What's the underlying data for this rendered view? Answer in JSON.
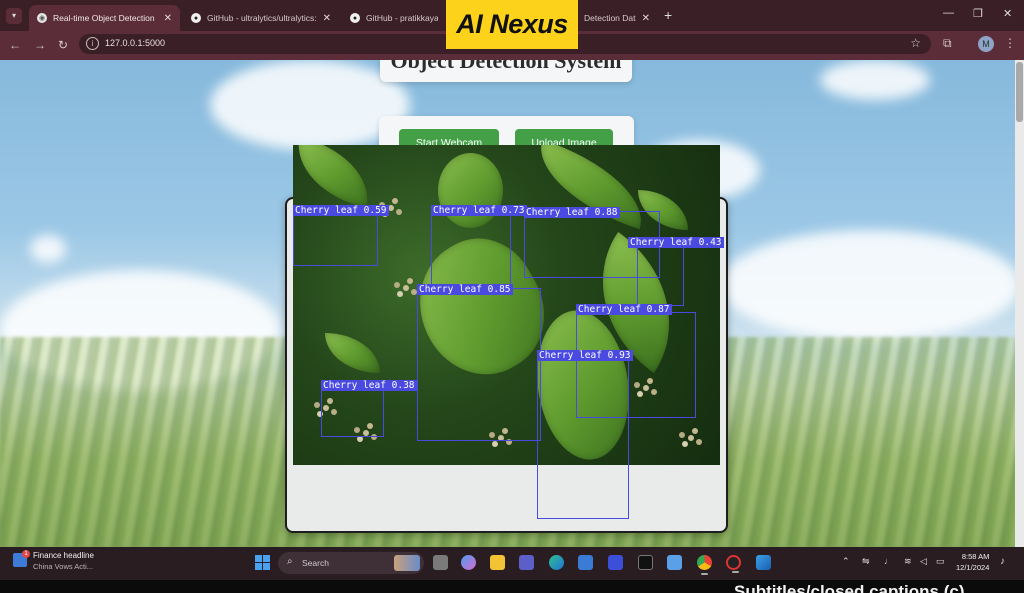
{
  "browser": {
    "tabs": [
      {
        "title": "Real-time Object Detection",
        "close": "✕"
      },
      {
        "title": "GitHub - ultralytics/ultralytics: U",
        "close": "✕"
      },
      {
        "title": "GitHub - pratikkayal/Pl",
        "close": "✕"
      },
      {
        "title": "Detection Datas",
        "close": "✕"
      }
    ],
    "new_tab": "+",
    "url": "127.0.0.1:5000",
    "profile_initial": "M",
    "window_controls": {
      "minimize": "—",
      "restore": "❐",
      "close": "✕"
    }
  },
  "overlay_brand": "AI Nexus",
  "app": {
    "title": "Object Detection System",
    "start_webcam_label": "Start Webcam",
    "upload_image_label": "Upload Image"
  },
  "detections": [
    {
      "label": "Cherry leaf 0.59"
    },
    {
      "label": "Cherry leaf 0.73"
    },
    {
      "label": "Cherry leaf 0.88"
    },
    {
      "label": "Cherry leaf 0.43"
    },
    {
      "label": "Cherry leaf 0.85"
    },
    {
      "label": "Cherry leaf 0.87"
    },
    {
      "label": "Cherry leaf 0.93"
    },
    {
      "label": "Cherry leaf 0.38"
    }
  ],
  "taskbar": {
    "news_title": "Finance headline",
    "news_subtitle": "China Vows Acti...",
    "news_badge": "1",
    "search_placeholder": "Search",
    "time": "8:58 AM",
    "date": "12/1/2024"
  },
  "subtitles_text": "Subtitles/closed captions (c)"
}
